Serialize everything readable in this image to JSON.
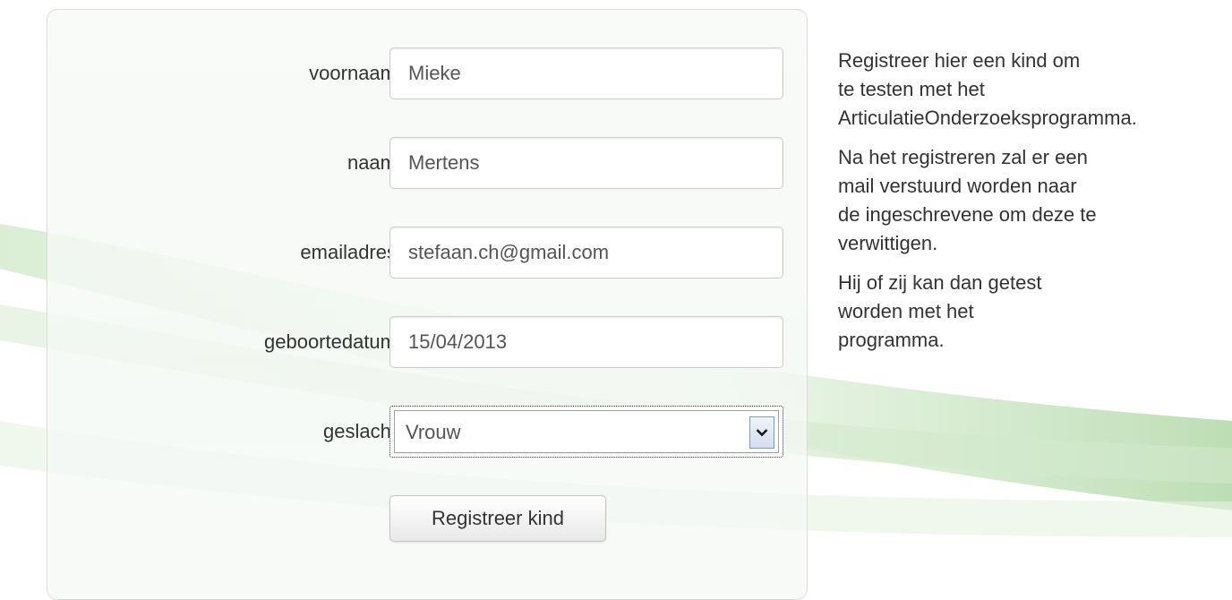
{
  "form": {
    "fields": [
      {
        "label": "voornaam",
        "value": "Mieke"
      },
      {
        "label": "naam",
        "value": "Mertens"
      },
      {
        "label": "emailadres",
        "value": "stefaan.ch@gmail.com"
      },
      {
        "label": "geboortedatum",
        "value": "15/04/2013"
      }
    ],
    "gender": {
      "label": "geslacht",
      "selected": "Vrouw",
      "arrow_icon": "chevron-down-icon"
    },
    "submit_label": "Registreer kind"
  },
  "info": {
    "paragraphs": [
      "Registreer hier een kind om te testen met het ArticulatieOnderzoeksprogramma.",
      "Na het registreren zal er een mail verstuurd worden naar de ingeschrevene om deze te verwittigen.",
      "Hij of zij kan dan getest worden met het programma."
    ]
  },
  "colors": {
    "background_swoosh": "#cfe9c8",
    "panel_border": "#dcdcdc",
    "text": "#333333"
  }
}
